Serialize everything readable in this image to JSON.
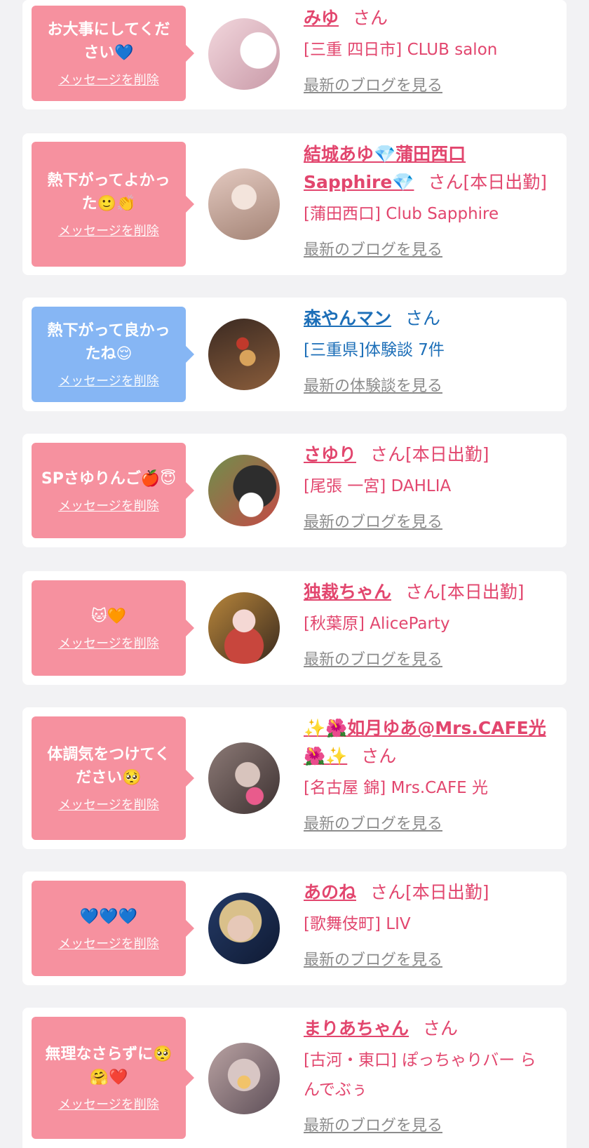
{
  "delete_label": "メッセージを削除",
  "items": [
    {
      "message": "お大事にしてください💙",
      "bubble_color": "#f6919f",
      "name": "みゆ",
      "suffix": "さん",
      "shop": "[三重 四日市] CLUB salon",
      "link": "最新のブログを見る",
      "avatar_colors": [
        "#f2d7dd",
        "#c99aa8"
      ]
    },
    {
      "message": "熱下がってよかった🙂👏",
      "bubble_color": "#f6919f",
      "name": "結城あゆ💎蒲田西口Sapphire💎",
      "suffix": "さん[本日出勤]",
      "shop": "[蒲田西口] Club Sapphire",
      "link": "最新のブログを見る",
      "avatar_colors": [
        "#e3c9c0",
        "#a48476"
      ]
    },
    {
      "message": "熱下がって良かったね😌",
      "bubble_color": "#86b6f4",
      "name": "森やんマン",
      "suffix": "さん",
      "shop": "[三重県]体験談 7件",
      "link": "最新の体験談を見る",
      "avatar_colors": [
        "#3b2a22",
        "#8a5d3b"
      ]
    },
    {
      "message": "SPさゆりんご🍎😇",
      "bubble_color": "#f6919f",
      "name": "さゆり",
      "suffix": "さん[本日出勤]",
      "shop": "[尾張 一宮] DAHLIA",
      "link": "最新のブログを見る",
      "avatar_colors": [
        "#6f8f4c",
        "#2d2d2d"
      ]
    },
    {
      "message": "🐱🧡",
      "bubble_color": "#f6919f",
      "name": "独裁ちゃん",
      "suffix": "さん[本日出勤]",
      "shop": "[秋葉原] AliceParty",
      "link": "最新のブログを見る",
      "avatar_colors": [
        "#c8463d",
        "#f4d8d4"
      ]
    },
    {
      "message": "体調気をつけてください🥺",
      "bubble_color": "#f6919f",
      "name": "✨🌺如月ゆあ@Mrs.CAFE光🌺✨",
      "suffix": "さん",
      "shop": "[名古屋 錦] Mrs.CAFE 光",
      "link": "最新のブログを見る",
      "avatar_colors": [
        "#8c7a76",
        "#3e3232"
      ]
    },
    {
      "message": "💙💙💙",
      "bubble_color": "#f6919f",
      "name": "あのね",
      "suffix": "さん[本日出勤]",
      "shop": "[歌舞伎町] LIV",
      "link": "最新のブログを見る",
      "avatar_colors": [
        "#243a66",
        "#e6c8b8"
      ]
    },
    {
      "message": "無理なさらずに🥺🤗❤️",
      "bubble_color": "#f6919f",
      "name": "まりあちゃん",
      "suffix": "さん",
      "shop": "[古河・東口] ぽっちゃりバー らんでぶぅ",
      "link": "最新のブログを見る",
      "avatar_colors": [
        "#b9a2a2",
        "#5e4f58"
      ]
    }
  ]
}
